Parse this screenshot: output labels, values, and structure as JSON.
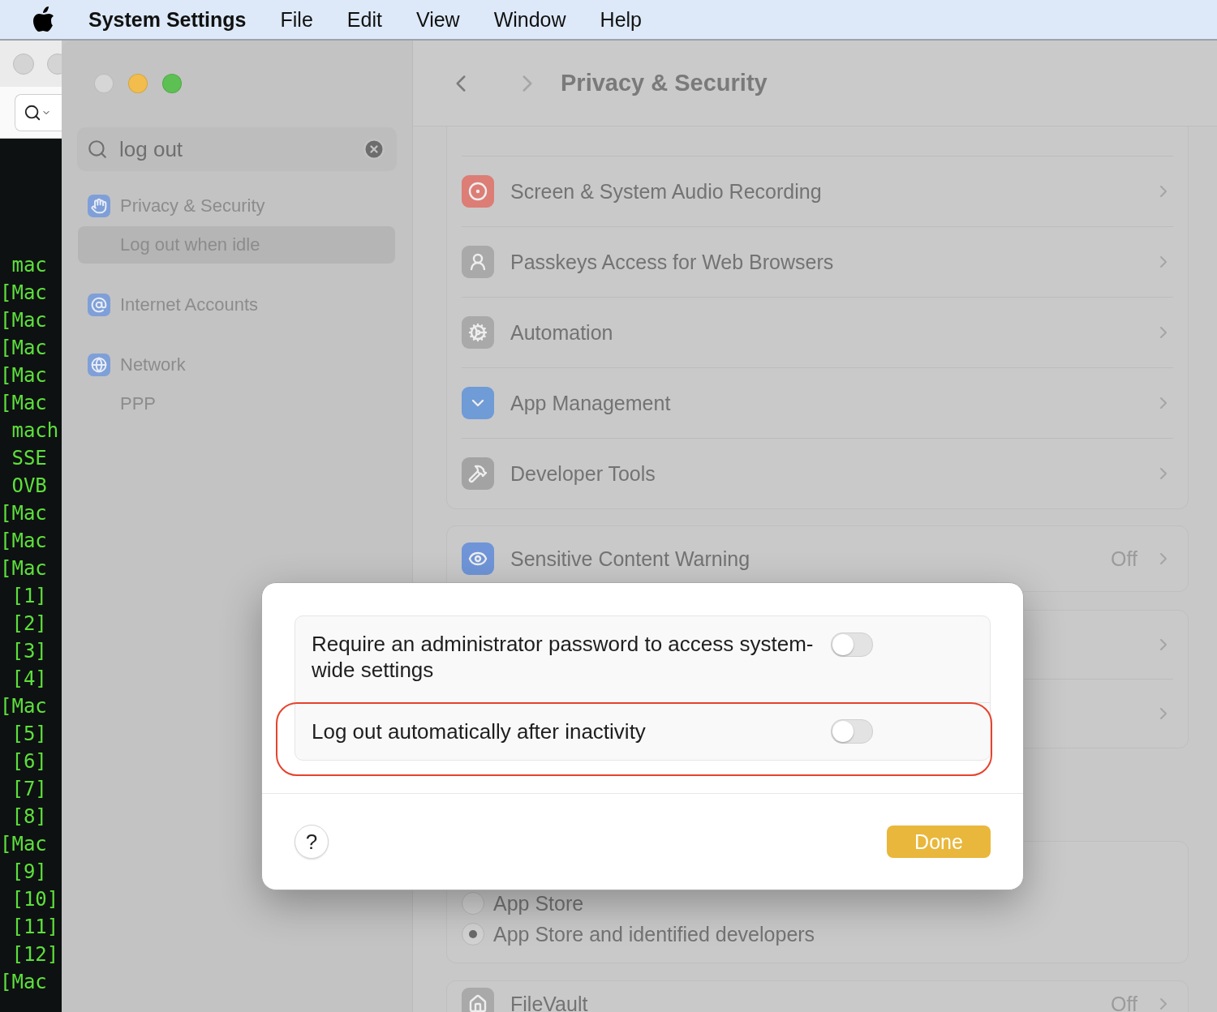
{
  "menu_bar": {
    "app_name": "System Settings",
    "items": [
      "File",
      "Edit",
      "View",
      "Window",
      "Help"
    ]
  },
  "terminal": {
    "lines": [
      " mac",
      "[Mac",
      "[Mac",
      "[Mac",
      "[Mac",
      "[Mac",
      " mach",
      " SSE",
      " OVB",
      "[Mac",
      "[Mac",
      "[Mac",
      " [1]",
      " [2]",
      " [3]",
      " [4]",
      "[Mac",
      " [5]",
      " [6]",
      " [7]",
      " [8]",
      "[Mac",
      " [9]",
      " [10]",
      " [11]",
      " [12]",
      "[Mac"
    ]
  },
  "sidebar": {
    "search": {
      "value": "log out"
    },
    "results": [
      {
        "label": "Privacy & Security",
        "selected": false,
        "children": [
          {
            "label": "Log out when idle",
            "selected": true
          }
        ]
      },
      {
        "label": "Internet Accounts",
        "selected": false
      },
      {
        "label": "Network",
        "selected": false,
        "children": [
          {
            "label": "PPP",
            "selected": false
          }
        ]
      }
    ]
  },
  "content": {
    "title": "Privacy & Security",
    "cards": [
      {
        "kind": "list",
        "rows": [
          {
            "label": "Screen & System Audio Recording"
          },
          {
            "label": "Passkeys Access for Web Browsers"
          },
          {
            "label": "Automation"
          },
          {
            "label": "App Management"
          },
          {
            "label": "Developer Tools"
          }
        ]
      },
      {
        "kind": "list",
        "rows": [
          {
            "label": "Sensitive Content Warning",
            "value": "Off"
          }
        ]
      },
      {
        "kind": "hidden-list"
      },
      {
        "kind": "radio",
        "options": [
          {
            "label": "App Store",
            "selected": false
          },
          {
            "label": "App Store and identified developers",
            "selected": true
          }
        ]
      },
      {
        "kind": "list",
        "rows": [
          {
            "label": "FileVault",
            "value": "Off"
          }
        ]
      }
    ]
  },
  "dialog": {
    "settings": [
      {
        "label": "Require an administrator password to access system-wide settings",
        "on": false,
        "highlighted": false
      },
      {
        "label": "Log out automatically after inactivity",
        "on": false,
        "highlighted": true
      }
    ],
    "help": "?",
    "done": "Done"
  }
}
